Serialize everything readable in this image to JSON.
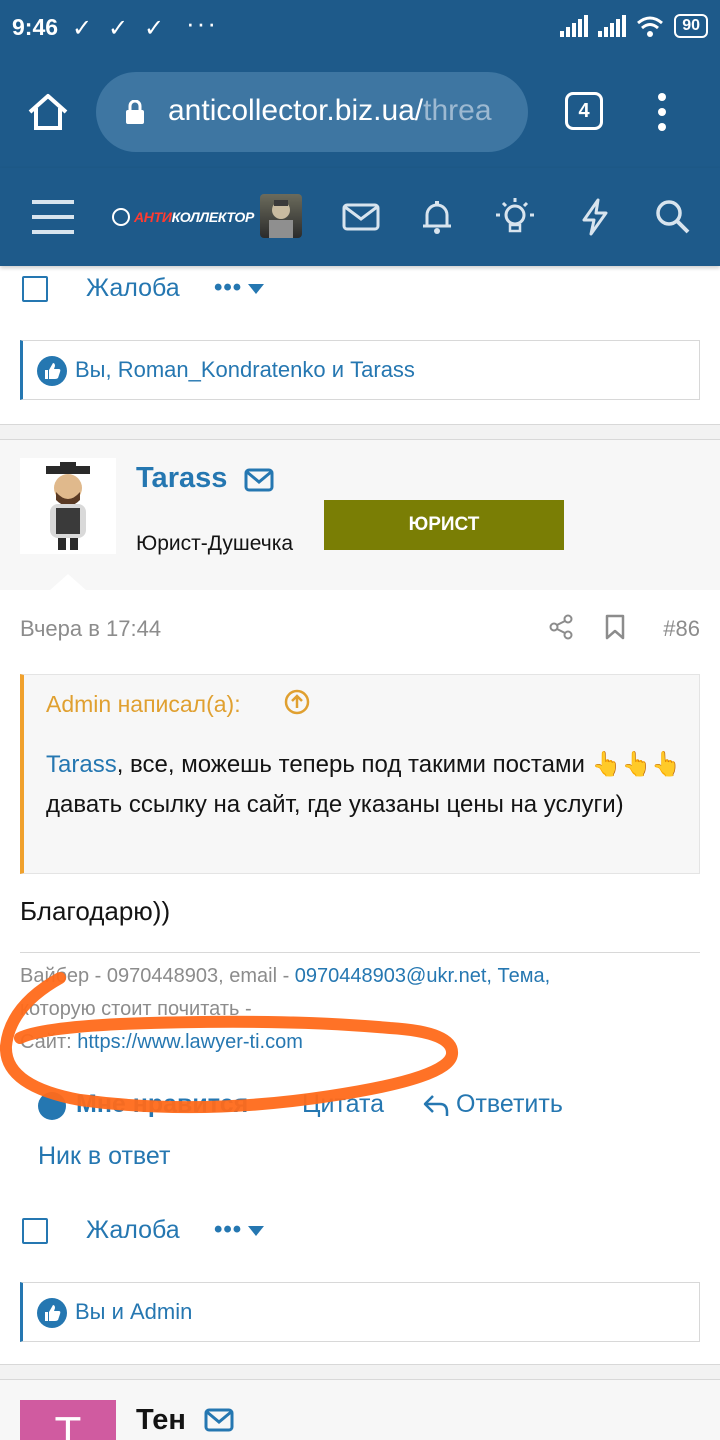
{
  "status_bar": {
    "time": "9:46",
    "notif_checks": [
      "✓",
      "✓",
      "✓"
    ],
    "more": "···",
    "battery": "90"
  },
  "browser": {
    "url_main": "anticollector.biz.ua/",
    "url_faded": "threa",
    "tab_count": "4"
  },
  "site": {
    "logo_red": "АНТИ",
    "logo_white": "КОЛЛЕКТОР",
    "colors": {
      "brand": "#1e5a8a",
      "link": "#2577b1",
      "quote_accent": "#f0a12d",
      "badge": "#7a7e05",
      "scribble": "#ff6a1a"
    }
  },
  "prev_post": {
    "report_label": "Жалоба",
    "more": "•••",
    "reactions": "Вы, Roman_Kondratenko и Tarass"
  },
  "post": {
    "username": "Tarass",
    "user_title": "Юрист-Душечка",
    "badge": "ЮРИСТ",
    "date": "Вчера в 17:44",
    "number": "#86",
    "quote": {
      "author": "Admin написал(а):",
      "mention": "Tarass",
      "text1": ", все, можешь теперь под такими постами",
      "emoji": "👆👆👆",
      "text2": " давать ссылку на сайт, где указаны цены на услуги)"
    },
    "body": "Благодарю))",
    "signature": {
      "line1_prefix": "Вайбер - 0970448903, email - ",
      "email": "0970448903@ukr.net",
      "line1_suffix": ", Тема,",
      "line2": "которую стоит почитать -",
      "site_label": "Сайт: ",
      "site_url": "https://www.lawyer-ti.com"
    },
    "actions": {
      "like": "Мне нравится",
      "quote": "Цитата",
      "reply": "Ответить",
      "nick": "Ник в ответ"
    },
    "report_label": "Жалоба",
    "more": "•••",
    "reactions": "Вы и Admin"
  },
  "next_post": {
    "username": "Тен",
    "avatar_letter": "Т"
  }
}
